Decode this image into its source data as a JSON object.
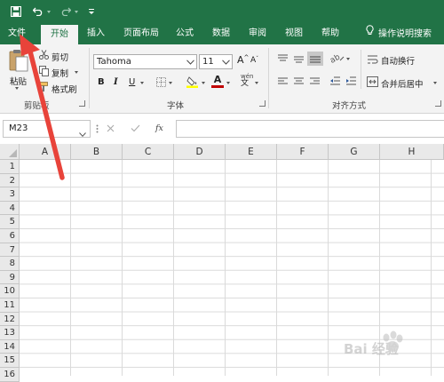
{
  "app": {
    "accent": "#217346",
    "ribbon_bg": "#f3f3f3"
  },
  "quick_access": {
    "icons": [
      "save-icon",
      "undo-icon",
      "redo-icon",
      "customize-icon"
    ]
  },
  "tabs": [
    {
      "label": "文件",
      "active": false
    },
    {
      "label": "开始",
      "active": true
    },
    {
      "label": "插入",
      "active": false
    },
    {
      "label": "页面布局",
      "active": false
    },
    {
      "label": "公式",
      "active": false
    },
    {
      "label": "数据",
      "active": false
    },
    {
      "label": "审阅",
      "active": false
    },
    {
      "label": "视图",
      "active": false
    },
    {
      "label": "帮助",
      "active": false
    }
  ],
  "tell_me": {
    "label": "操作说明搜索",
    "icon": "lightbulb-icon"
  },
  "clipboard": {
    "paste": "粘贴",
    "cut": "剪切",
    "copy": "复制",
    "format_painter": "格式刷",
    "group_label": "剪贴板"
  },
  "font": {
    "name": "Tahoma",
    "size": "11",
    "group_label": "字体",
    "bold": "B",
    "italic": "I",
    "underline": "U",
    "grow": "A",
    "shrink": "A",
    "phonetic": "wén",
    "font_color": "#c00000",
    "fill_color": "#ffff00"
  },
  "alignment": {
    "wrap": "自动换行",
    "merge": "合并后居中",
    "group_label": "对齐方式"
  },
  "formula_bar": {
    "name_box": "M23",
    "fx": "fx",
    "value": ""
  },
  "columns": [
    "A",
    "B",
    "C",
    "D",
    "E",
    "F",
    "G",
    "H"
  ],
  "rows": [
    "1",
    "2",
    "3",
    "4",
    "5",
    "6",
    "7",
    "8",
    "9",
    "10",
    "11",
    "12",
    "13",
    "14",
    "15",
    "16"
  ],
  "watermark": "Bai 经验"
}
